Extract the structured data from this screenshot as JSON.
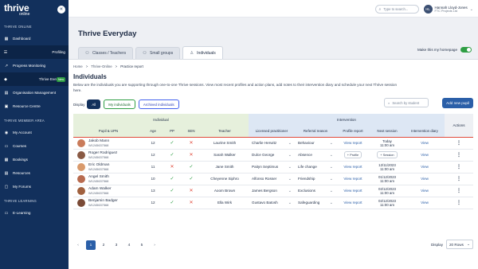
{
  "app": {
    "logo_main": "thrive",
    "logo_sub": "online",
    "collapse_icon": "«"
  },
  "sidebar": {
    "section1": "THRIVE ONLINE",
    "items1": [
      {
        "label": "Dashboard",
        "icon": "▦"
      },
      {
        "label": "Profiling",
        "icon": "☰"
      },
      {
        "label": "Progress Monitoring",
        "icon": "↗"
      },
      {
        "label": "Thrive Everyday",
        "icon": "◆",
        "badge": "New"
      },
      {
        "label": "Organisation Management",
        "icon": "▤"
      },
      {
        "label": "Resource Centre",
        "icon": "▣"
      }
    ],
    "section2": "THRIVE MEMBER AREA",
    "items2": [
      {
        "label": "My Account",
        "icon": "◉"
      },
      {
        "label": "Courses",
        "icon": "▭"
      },
      {
        "label": "Bookings",
        "icon": "▦"
      },
      {
        "label": "Resources",
        "icon": "▤"
      },
      {
        "label": "My Forums",
        "icon": "▢"
      }
    ],
    "section3": "THRIVE LEARNING",
    "items3": [
      {
        "label": "E-Learning",
        "icon": "▭"
      }
    ]
  },
  "topbar": {
    "search_placeholder": "Type to search...",
    "user_initials": "HL",
    "user_name": "Hannah Lloyd-Jones",
    "user_org": "FTC Projects Ltd"
  },
  "page": {
    "title": "Thrive Everyday",
    "homepage_label": "Make this my homepage"
  },
  "tabs": [
    {
      "label": "Classes / Teachers",
      "icon": "⚇"
    },
    {
      "label": "Small groups",
      "icon": "⚇"
    },
    {
      "label": "Individuals",
      "icon": "♙"
    }
  ],
  "breadcrumb": [
    "Home",
    ">",
    "Thrive-Online",
    ">",
    "Practice report"
  ],
  "section": {
    "title": "Individuals",
    "description": "Below are the individuals you are supporting through one-to-one Thrive sessions. View most recent profiles and action plans, add notes to their intervention diary and schedule  your next Thrive session here."
  },
  "filters": {
    "label": "Display",
    "all": "All",
    "mine": "My individuals",
    "archived": "Archived  individuals",
    "search_placeholder": "Search by student",
    "add": "Add new pupil"
  },
  "table": {
    "groups": {
      "individual": "Individual",
      "intervention": "Intervention",
      "actions": "Actions"
    },
    "columns": [
      "Pupil & UPN",
      "Age",
      "PP",
      "SEN",
      "Teacher",
      "Licensed practitioner",
      "Referral reason",
      "Profile report",
      "Next session",
      "Intervention diary"
    ],
    "rows": [
      {
        "name": "Jakob Mann",
        "upn": "W1245637568",
        "age": "12",
        "teacher": "Laurine Smith",
        "practitioner": "Charlie Herwitz",
        "reason": "Behaviour",
        "profile": "View report",
        "next1": "Today",
        "next2": "11:00 am",
        "diary": "View",
        "avatar": "#c97b5a"
      },
      {
        "name": "Roger Rodriguez",
        "upn": "W1245637568",
        "age": "12",
        "teacher": "Sarah Walker",
        "practitioner": "Dulce George",
        "reason": "Absence",
        "profile": "+ Profile",
        "next1": "+ Session",
        "next2": "",
        "diary": "View",
        "avatar": "#8a5a44"
      },
      {
        "name": "Eric Oldman",
        "upn": "W1245637568",
        "age": "11",
        "teacher": "Jane Smith",
        "practitioner": "Paityn Septimus",
        "reason": "Life change",
        "profile": "View report",
        "next1": "12/11/2023",
        "next2": "11:00 am",
        "diary": "View",
        "avatar": "#d99a6c"
      },
      {
        "name": "Angel Smith",
        "upn": "W1245637568",
        "age": "10",
        "teacher": "Cheyenne Siphro",
        "practitioner": "Alfonso Rosser",
        "reason": "Friendship",
        "profile": "View report",
        "next1": "01/12/2023",
        "next2": "11:00 am",
        "diary": "View",
        "avatar": "#b86b4f"
      },
      {
        "name": "Adam Walker",
        "upn": "W1245637568",
        "age": "13",
        "teacher": "Aoom Brown",
        "practitioner": "James Bergson",
        "reason": "Exclusions",
        "profile": "View report",
        "next1": "02/12/2023",
        "next2": "11:00 am",
        "diary": "View",
        "avatar": "#a0603e"
      },
      {
        "name": "Benjamin Badger",
        "upn": "W1245637568",
        "age": "12",
        "teacher": "Ella Wirk",
        "practitioner": "Gustavo Batosh",
        "reason": "Safeguarding",
        "profile": "View report",
        "next1": "02/12/2023",
        "next2": "11:00 am",
        "diary": "View",
        "avatar": "#7a4a36"
      }
    ]
  },
  "pager": {
    "prev": "‹",
    "pages": [
      "1",
      "2",
      "3",
      "4",
      "5"
    ],
    "next": "›",
    "display_label": "Display",
    "rows": "20 Rows"
  }
}
